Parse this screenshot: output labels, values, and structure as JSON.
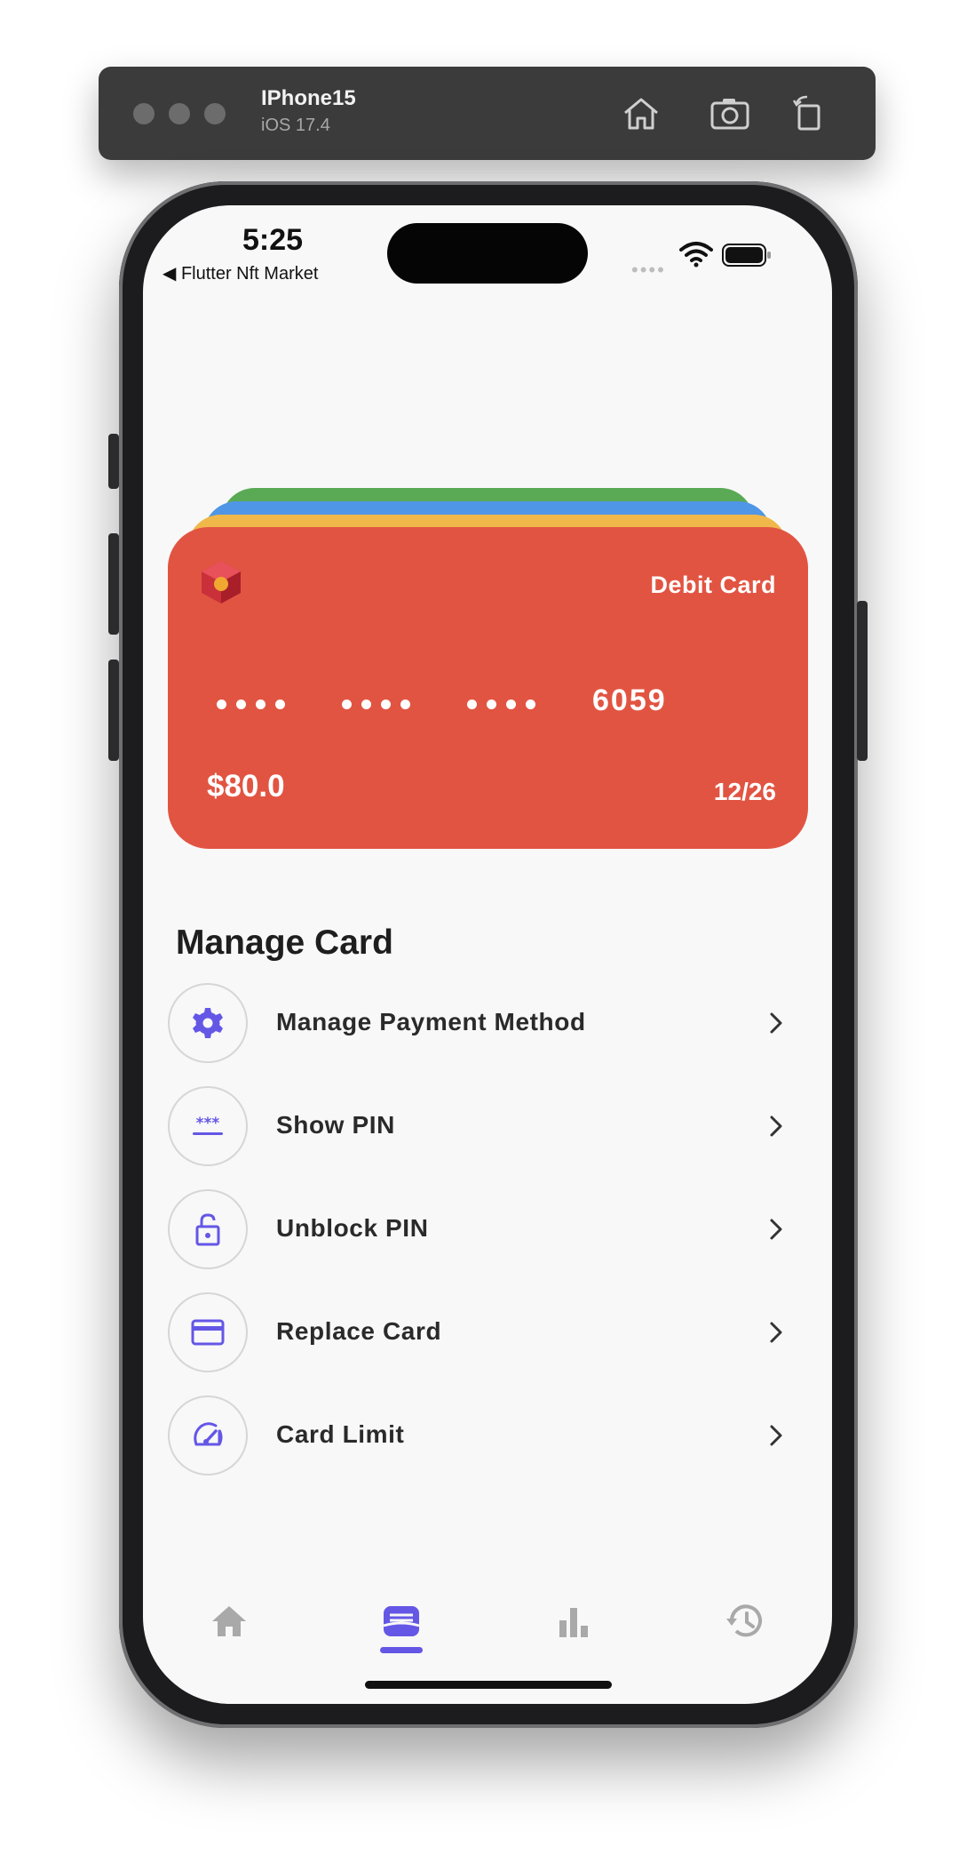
{
  "simulator": {
    "device_name": "IPhone15",
    "os_version": "iOS 17.4",
    "toolbar_icons": [
      "home-icon",
      "screenshot-icon",
      "rotate-icon"
    ]
  },
  "status_bar": {
    "time": "5:25",
    "back_app": "◀ Flutter Nft Market"
  },
  "card": {
    "type_label": "Debit Card",
    "last4": "6059",
    "balance": "$80.0",
    "expiry": "12/26",
    "color": "#e25442",
    "stack_colors": [
      "#5aaa55",
      "#4f96e6",
      "#f0b84a"
    ]
  },
  "manage": {
    "title": "Manage Card",
    "items": [
      {
        "label": "Manage Payment Method",
        "icon": "gear-icon"
      },
      {
        "label": "Show PIN",
        "icon": "pin-asterisk-icon"
      },
      {
        "label": "Unblock PIN",
        "icon": "unlock-icon"
      },
      {
        "label": "Replace Card",
        "icon": "credit-card-icon"
      },
      {
        "label": "Card Limit",
        "icon": "speedometer-icon"
      }
    ]
  },
  "tabbar": {
    "tabs": [
      "home-icon",
      "wallet-icon",
      "bar-chart-icon",
      "history-icon"
    ],
    "active_tab": "wallet-icon",
    "accent_color": "#6457e6"
  }
}
